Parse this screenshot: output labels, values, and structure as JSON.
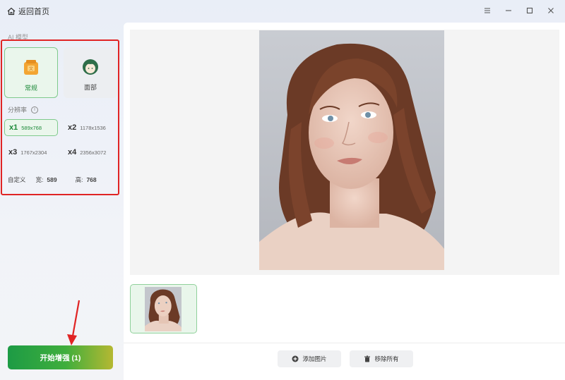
{
  "titlebar": {
    "home_label": "返回首页",
    "controls": [
      "menu-icon",
      "minimize-icon",
      "maximize-icon",
      "close-icon"
    ]
  },
  "sidebar": {
    "model_section_label": "AI 模型",
    "models": [
      {
        "label": "常规",
        "icon": "general-icon",
        "active": true
      },
      {
        "label": "面部",
        "icon": "face-icon",
        "active": false
      }
    ],
    "resolution_label": "分辨率",
    "resolutions": [
      {
        "mult": "x1",
        "dim": "589x768",
        "active": true
      },
      {
        "mult": "x2",
        "dim": "1178x1536",
        "active": false
      },
      {
        "mult": "x3",
        "dim": "1767x2304",
        "active": false
      },
      {
        "mult": "x4",
        "dim": "2356x3072",
        "active": false
      }
    ],
    "custom": {
      "label": "自定义",
      "width_label": "宽:",
      "width_value": "589",
      "height_label": "高:",
      "height_value": "768"
    },
    "start_button": "开始增强 (1)"
  },
  "main": {
    "add_button": "添加图片",
    "remove_button": "移除所有"
  },
  "colors": {
    "accent": "#1e8a3a",
    "highlight": "#e02424"
  }
}
